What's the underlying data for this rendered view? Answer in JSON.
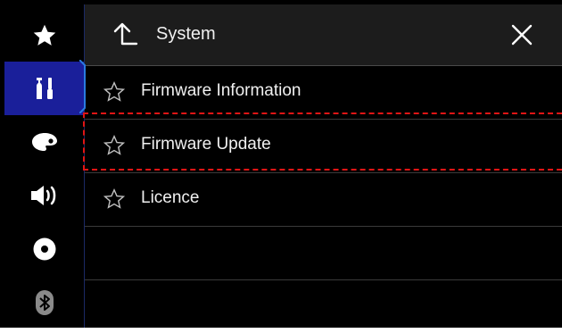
{
  "header": {
    "title": "System",
    "back_icon": "back-arrow-icon",
    "close_icon": "close-icon"
  },
  "sidebar": {
    "items": [
      {
        "icon": "star-icon",
        "active": false
      },
      {
        "icon": "settings-tools-icon",
        "active": true
      },
      {
        "icon": "palette-icon",
        "active": false
      },
      {
        "icon": "speaker-icon",
        "active": false
      },
      {
        "icon": "disc-icon",
        "active": false
      },
      {
        "icon": "bluetooth-icon",
        "active": false
      }
    ]
  },
  "menu": {
    "items": [
      {
        "label": "Firmware Information",
        "icon": "star-outline-icon"
      },
      {
        "label": "Firmware Update",
        "icon": "star-outline-icon",
        "highlighted": true
      },
      {
        "label": "Licence",
        "icon": "star-outline-icon"
      }
    ]
  },
  "colors": {
    "active_sidebar": "#1a1f9a",
    "highlight_dash": "#e01515",
    "header_bg": "#1c1c1c"
  }
}
